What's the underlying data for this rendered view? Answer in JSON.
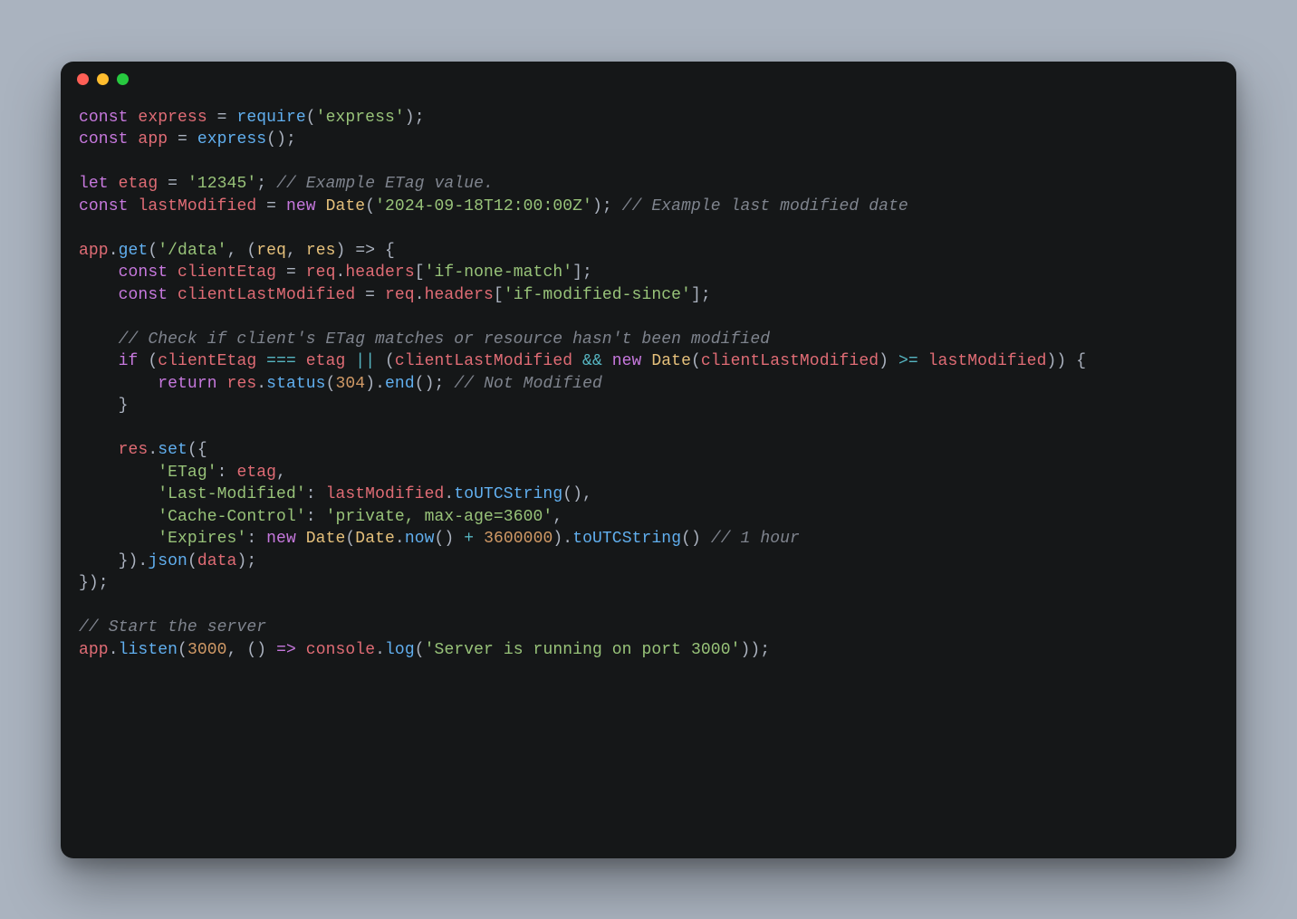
{
  "window": {
    "traffic_lights": [
      "red",
      "yellow",
      "green"
    ]
  },
  "code": {
    "l1": {
      "kw1": "const",
      "sp": " ",
      "v": "express",
      "eq": " = ",
      "fn": "require",
      "op": "(",
      "s": "'express'",
      "cp": ");"
    },
    "l2": {
      "kw1": "const",
      "sp": " ",
      "v": "app",
      "eq": " = ",
      "fn": "express",
      "call": "();"
    },
    "l3": "",
    "l4": {
      "kw1": "let",
      "sp": " ",
      "v": "etag",
      "eq": " = ",
      "s": "'12345'",
      "semi": "; ",
      "com": "// Example ETag value."
    },
    "l5": {
      "kw1": "const",
      "sp": " ",
      "v": "lastModified",
      "eq": " = ",
      "kw2": "new",
      "sp2": " ",
      "cls": "Date",
      "op": "(",
      "s": "'2024-09-18T12:00:00Z'",
      "cp": "); ",
      "com": "// Example last modified date"
    },
    "l6": "",
    "l7": {
      "obj": "app",
      "dot": ".",
      "fn": "get",
      "op": "(",
      "s": "'/data'",
      "comma": ", (",
      "p1": "req",
      "c2": ", ",
      "p2": "res",
      "arrow": ") => {"
    },
    "l8": {
      "ind": "    ",
      "kw": "const",
      "sp": " ",
      "v": "clientEtag",
      "eq": " = ",
      "o": "req",
      "d": ".",
      "p": "headers",
      "br": "[",
      "s": "'if-none-match'",
      "cb": "];"
    },
    "l9": {
      "ind": "    ",
      "kw": "const",
      "sp": " ",
      "v": "clientLastModified",
      "eq": " = ",
      "o": "req",
      "d": ".",
      "p": "headers",
      "br": "[",
      "s": "'if-modified-since'",
      "cb": "];"
    },
    "l10": "",
    "l11": {
      "ind": "    ",
      "com": "// Check if client's ETag matches or resource hasn't been modified"
    },
    "l12": {
      "ind": "    ",
      "kw": "if",
      "sp": " (",
      "a": "clientEtag",
      "op1": " === ",
      "b": "etag",
      "op2": " || ",
      "op3": "(",
      "c": "clientLastModified",
      "op4": " && ",
      "kw2": "new",
      "sp2": " ",
      "cls": "Date",
      "p1": "(",
      "d": "clientLastModified",
      "p2": ") ",
      "op5": ">= ",
      "e": "lastModified",
      "p3": ")) {"
    },
    "l13": {
      "ind": "        ",
      "kw": "return",
      "sp": " ",
      "o": "res",
      "d": ".",
      "fn": "status",
      "op": "(",
      "n": "304",
      "cp": ").",
      "fn2": "end",
      "call": "(); ",
      "com": "// Not Modified"
    },
    "l14": {
      "ind": "    ",
      "txt": "}"
    },
    "l15": "",
    "l16": {
      "ind": "    ",
      "o": "res",
      "d": ".",
      "fn": "set",
      "op": "({"
    },
    "l17": {
      "ind": "        ",
      "k": "'ETag'",
      "c": ": ",
      "v": "etag",
      "e": ","
    },
    "l18": {
      "ind": "        ",
      "k": "'Last-Modified'",
      "c": ": ",
      "v": "lastModified",
      "d": ".",
      "fn": "toUTCString",
      "call": "(),"
    },
    "l19": {
      "ind": "        ",
      "k": "'Cache-Control'",
      "c": ": ",
      "v": "'private, max-age=3600'",
      "e": ","
    },
    "l20": {
      "ind": "        ",
      "k": "'Expires'",
      "c": ": ",
      "kw": "new",
      "sp": " ",
      "cls": "Date",
      "op": "(",
      "cls2": "Date",
      "d": ".",
      "fn": "now",
      "call": "() ",
      "op2": "+ ",
      "n": "3600000",
      "cp": ").",
      "fn2": "toUTCString",
      "call2": "() ",
      "com": "// 1 hour"
    },
    "l21": {
      "ind": "    ",
      "txt": "}).",
      "fn": "json",
      "op": "(",
      "v": "data",
      "cp": ");"
    },
    "l22": {
      "txt": "});"
    },
    "l23": "",
    "l24": {
      "com": "// Start the server"
    },
    "l25": {
      "o": "app",
      "d": ".",
      "fn": "listen",
      "op": "(",
      "n": "3000",
      "c": ", () ",
      "ar": "=>",
      "sp": " ",
      "o2": "console",
      "d2": ".",
      "fn2": "log",
      "op2": "(",
      "s": "'Server is running on port 3000'",
      "cp": "));"
    }
  }
}
